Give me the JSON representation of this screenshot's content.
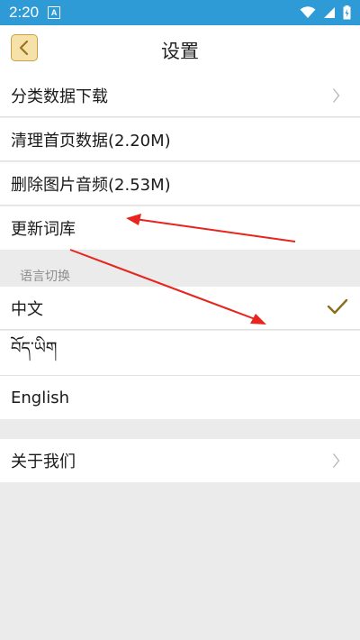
{
  "status": {
    "time": "2:20"
  },
  "header": {
    "title": "设置"
  },
  "settings": {
    "items": [
      {
        "label": "分类数据下载"
      },
      {
        "label": "清理首页数据(2.20M)"
      },
      {
        "label": "删除图片音频(2.53M)"
      },
      {
        "label": "更新词库"
      }
    ]
  },
  "language": {
    "section_title": "语言切换",
    "options": [
      {
        "label": "中文",
        "selected": true
      },
      {
        "label": "བོད་ཡིག",
        "selected": false
      },
      {
        "label": "English",
        "selected": false
      }
    ]
  },
  "about": {
    "label": "关于我们"
  },
  "colors": {
    "status_bar": "#2f9bd6",
    "accent": "#8a6d1a",
    "annotation_arrow": "#e8241e"
  }
}
